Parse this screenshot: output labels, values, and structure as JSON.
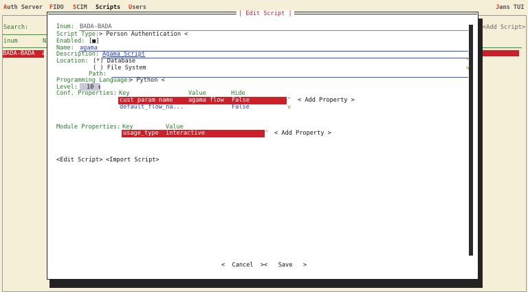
{
  "menu": {
    "items": [
      {
        "hot": "A",
        "rest": "uth Server"
      },
      {
        "hot": "F",
        "rest": "IDO"
      },
      {
        "hot": "S",
        "rest": "CIM"
      },
      {
        "hot": "Scr",
        "rest": "ipts",
        "prefix": ""
      },
      {
        "hot": "U",
        "rest": "sers"
      }
    ],
    "right_hot": "J",
    "right_rest": "ans TUI"
  },
  "background": {
    "search_label": "Search:",
    "add_script": "<Add Script>",
    "col_inum": "inum",
    "col_n": "N",
    "row_inum": "BADA-BADA",
    "row_a": "a"
  },
  "dialog": {
    "title": "Edit Script",
    "inum_label": "Inum:",
    "inum_value": "BADA-BADA",
    "script_type_label": "Script Type:",
    "script_type_value": "> Person Authentication <",
    "enabled_label": "Enabled:",
    "enabled_value": "[■]",
    "name_label": "Name:",
    "name_value": "agama",
    "description_label": "Description:",
    "description_value": "Agama Script",
    "location_label": "Location:",
    "location_db": "(*) Database",
    "location_fs": "( ) File System",
    "path_label": "Path:",
    "prog_lang_label": "Programming Language:",
    "prog_lang_value": "> Python <",
    "level_label": "Level:",
    "level_value": "10",
    "level_arrows": "↕",
    "conf_props_label": "Conf. Properties:",
    "conf_headers": {
      "key": "Key",
      "value": "Value",
      "hide": "Hide"
    },
    "conf_rows": [
      {
        "key": "cust param name",
        "value": "agama flow",
        "hide": "False"
      },
      {
        "key": "default_flow_na...",
        "value": "",
        "hide": "False"
      }
    ],
    "add_property": "< Add Property >",
    "module_props_label": "Module Properties:",
    "module_headers": {
      "key": "Key",
      "value": "Value"
    },
    "module_rows": [
      {
        "key": "usage_type",
        "value": "interactive"
      }
    ],
    "add_property_2": "< Add Property >",
    "edit_script": "<Edit Script>",
    "import_script": "<Import Script>",
    "cancel": "<  Cancel  >",
    "save": "<   Save   >",
    "scroll_up": "^",
    "scroll_down": "v"
  }
}
